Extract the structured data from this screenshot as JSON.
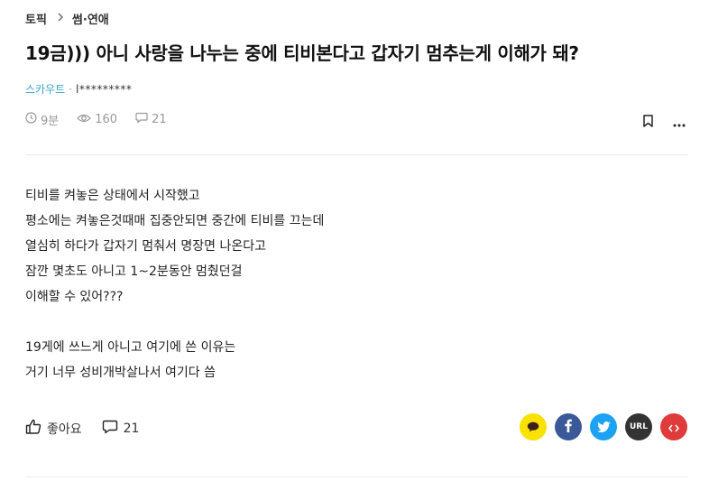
{
  "breadcrumb": {
    "root": "토픽",
    "category": "썸·연애"
  },
  "post": {
    "title": "19금))) 아니 사랑을 나누는 중에 티비본다고 갑자기 멈추는게 이해가 돼?",
    "channel": "스카우트",
    "separator": "·",
    "author": "l*********",
    "time": "9분",
    "views": "160",
    "comments": "21",
    "body": [
      "티비를 켜놓은 상태에서 시작했고",
      "평소에는 켜놓은것때매 집중안되면 중간에 티비를 끄는데",
      "열심히 하다가 갑자기 멈춰서 명장면 나온다고",
      "잠깐 몇초도 아니고 1~2분동안 멈췄던걸",
      "이해할 수 있어???",
      "",
      "19게에 쓰느게 아니고 여기에 쓴 이유는",
      "거기 너무 성비개박살나서 여기다 씀"
    ]
  },
  "actions": {
    "like_label": "좋아요",
    "comment_count": "21"
  },
  "share": {
    "url_label": "URL",
    "colors": {
      "kakao": "#fae100",
      "facebook": "#3b5998",
      "twitter": "#1da1f2",
      "url": "#333333",
      "embed": "#e03b3b"
    }
  }
}
